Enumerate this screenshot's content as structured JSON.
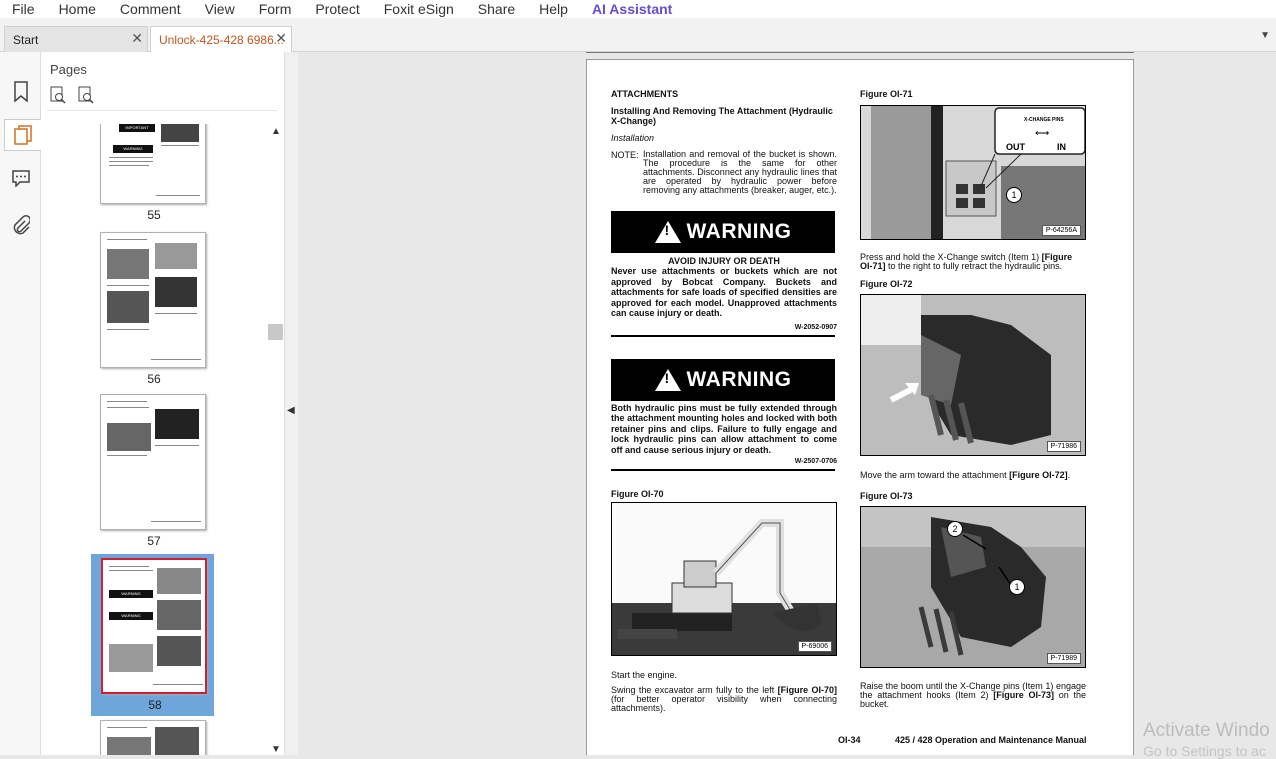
{
  "menu": [
    "File",
    "Home",
    "Comment",
    "View",
    "Form",
    "Protect",
    "Foxit eSign",
    "Share",
    "Help",
    "AI Assistant"
  ],
  "tabs": {
    "start": "Start",
    "doc": "Unlock-425-428 6986..."
  },
  "panel": {
    "title": "Pages"
  },
  "thumbnails": [
    {
      "num": "55"
    },
    {
      "num": "56"
    },
    {
      "num": "57"
    },
    {
      "num": "58"
    }
  ],
  "page": {
    "heading": "ATTACHMENTS",
    "subheading": "Installing And Removing The Attachment (Hydraulic X-Change)",
    "installation": "Installation",
    "note_label": "NOTE:",
    "note_text": "Installation and removal of the bucket is shown. The procedure is the same for other attachments. Disconnect any hydraulic lines that are operated by hydraulic power before removing any attachments (breaker, auger, etc.).",
    "warning_word": "WARNING",
    "warn1_title": "AVOID INJURY OR DEATH",
    "warn1_text": "Never use attachments or buckets which are not approved by Bobcat Company. Buckets and attachments for safe loads of specified densities are approved for each model. Unapproved attachments can cause injury or death.",
    "warn1_code": "W-2052-0907",
    "warn2_text": "Both hydraulic pins must be fully extended through the attachment mounting holes and locked with both retainer pins and clips. Failure to fully engage and lock hydraulic pins can allow attachment to come off and cause serious injury or death.",
    "warn2_code": "W-2507-0706",
    "fig70": "Figure OI-70",
    "fig70_code": "P-69006",
    "start_engine": "Start the engine.",
    "swing_a": "Swing the excavator arm fully to the left ",
    "swing_ref": "[Figure OI-70]",
    "swing_b": " (for better operator visibility when connecting attachments).",
    "fig71": "Figure OI-71",
    "fig71_code": "P-64256A",
    "xchange_label": "X-CHANGE PINS",
    "out": "OUT",
    "in": "IN",
    "callout1": "1",
    "callout2": "2",
    "press_a": "Press and hold the X-Change switch (Item 1) ",
    "press_ref": "[Figure OI-71]",
    "press_b": " to the right to fully retract the hydraulic pins.",
    "fig72": "Figure OI-72",
    "fig72_code": "P-71986",
    "move_a": "Move the arm toward the attachment ",
    "move_ref": "[Figure OI-72]",
    "move_b": ".",
    "fig73": "Figure OI-73",
    "fig73_code": "P-71989",
    "raise_a": "Raise the boom until the X-Change pins (Item 1) engage the attachment hooks (Item 2) ",
    "raise_ref": "[Figure OI-73]",
    "raise_b": " on the bucket.",
    "footer_page": "OI-34",
    "footer_title": "425 / 428 Operation and Maintenance Manual",
    "thumb_important": "IMPORTANT",
    "thumb_warning": "WARNING"
  },
  "watermark": {
    "line1": "Activate Windo",
    "line2": "Go to Settings to ac"
  }
}
